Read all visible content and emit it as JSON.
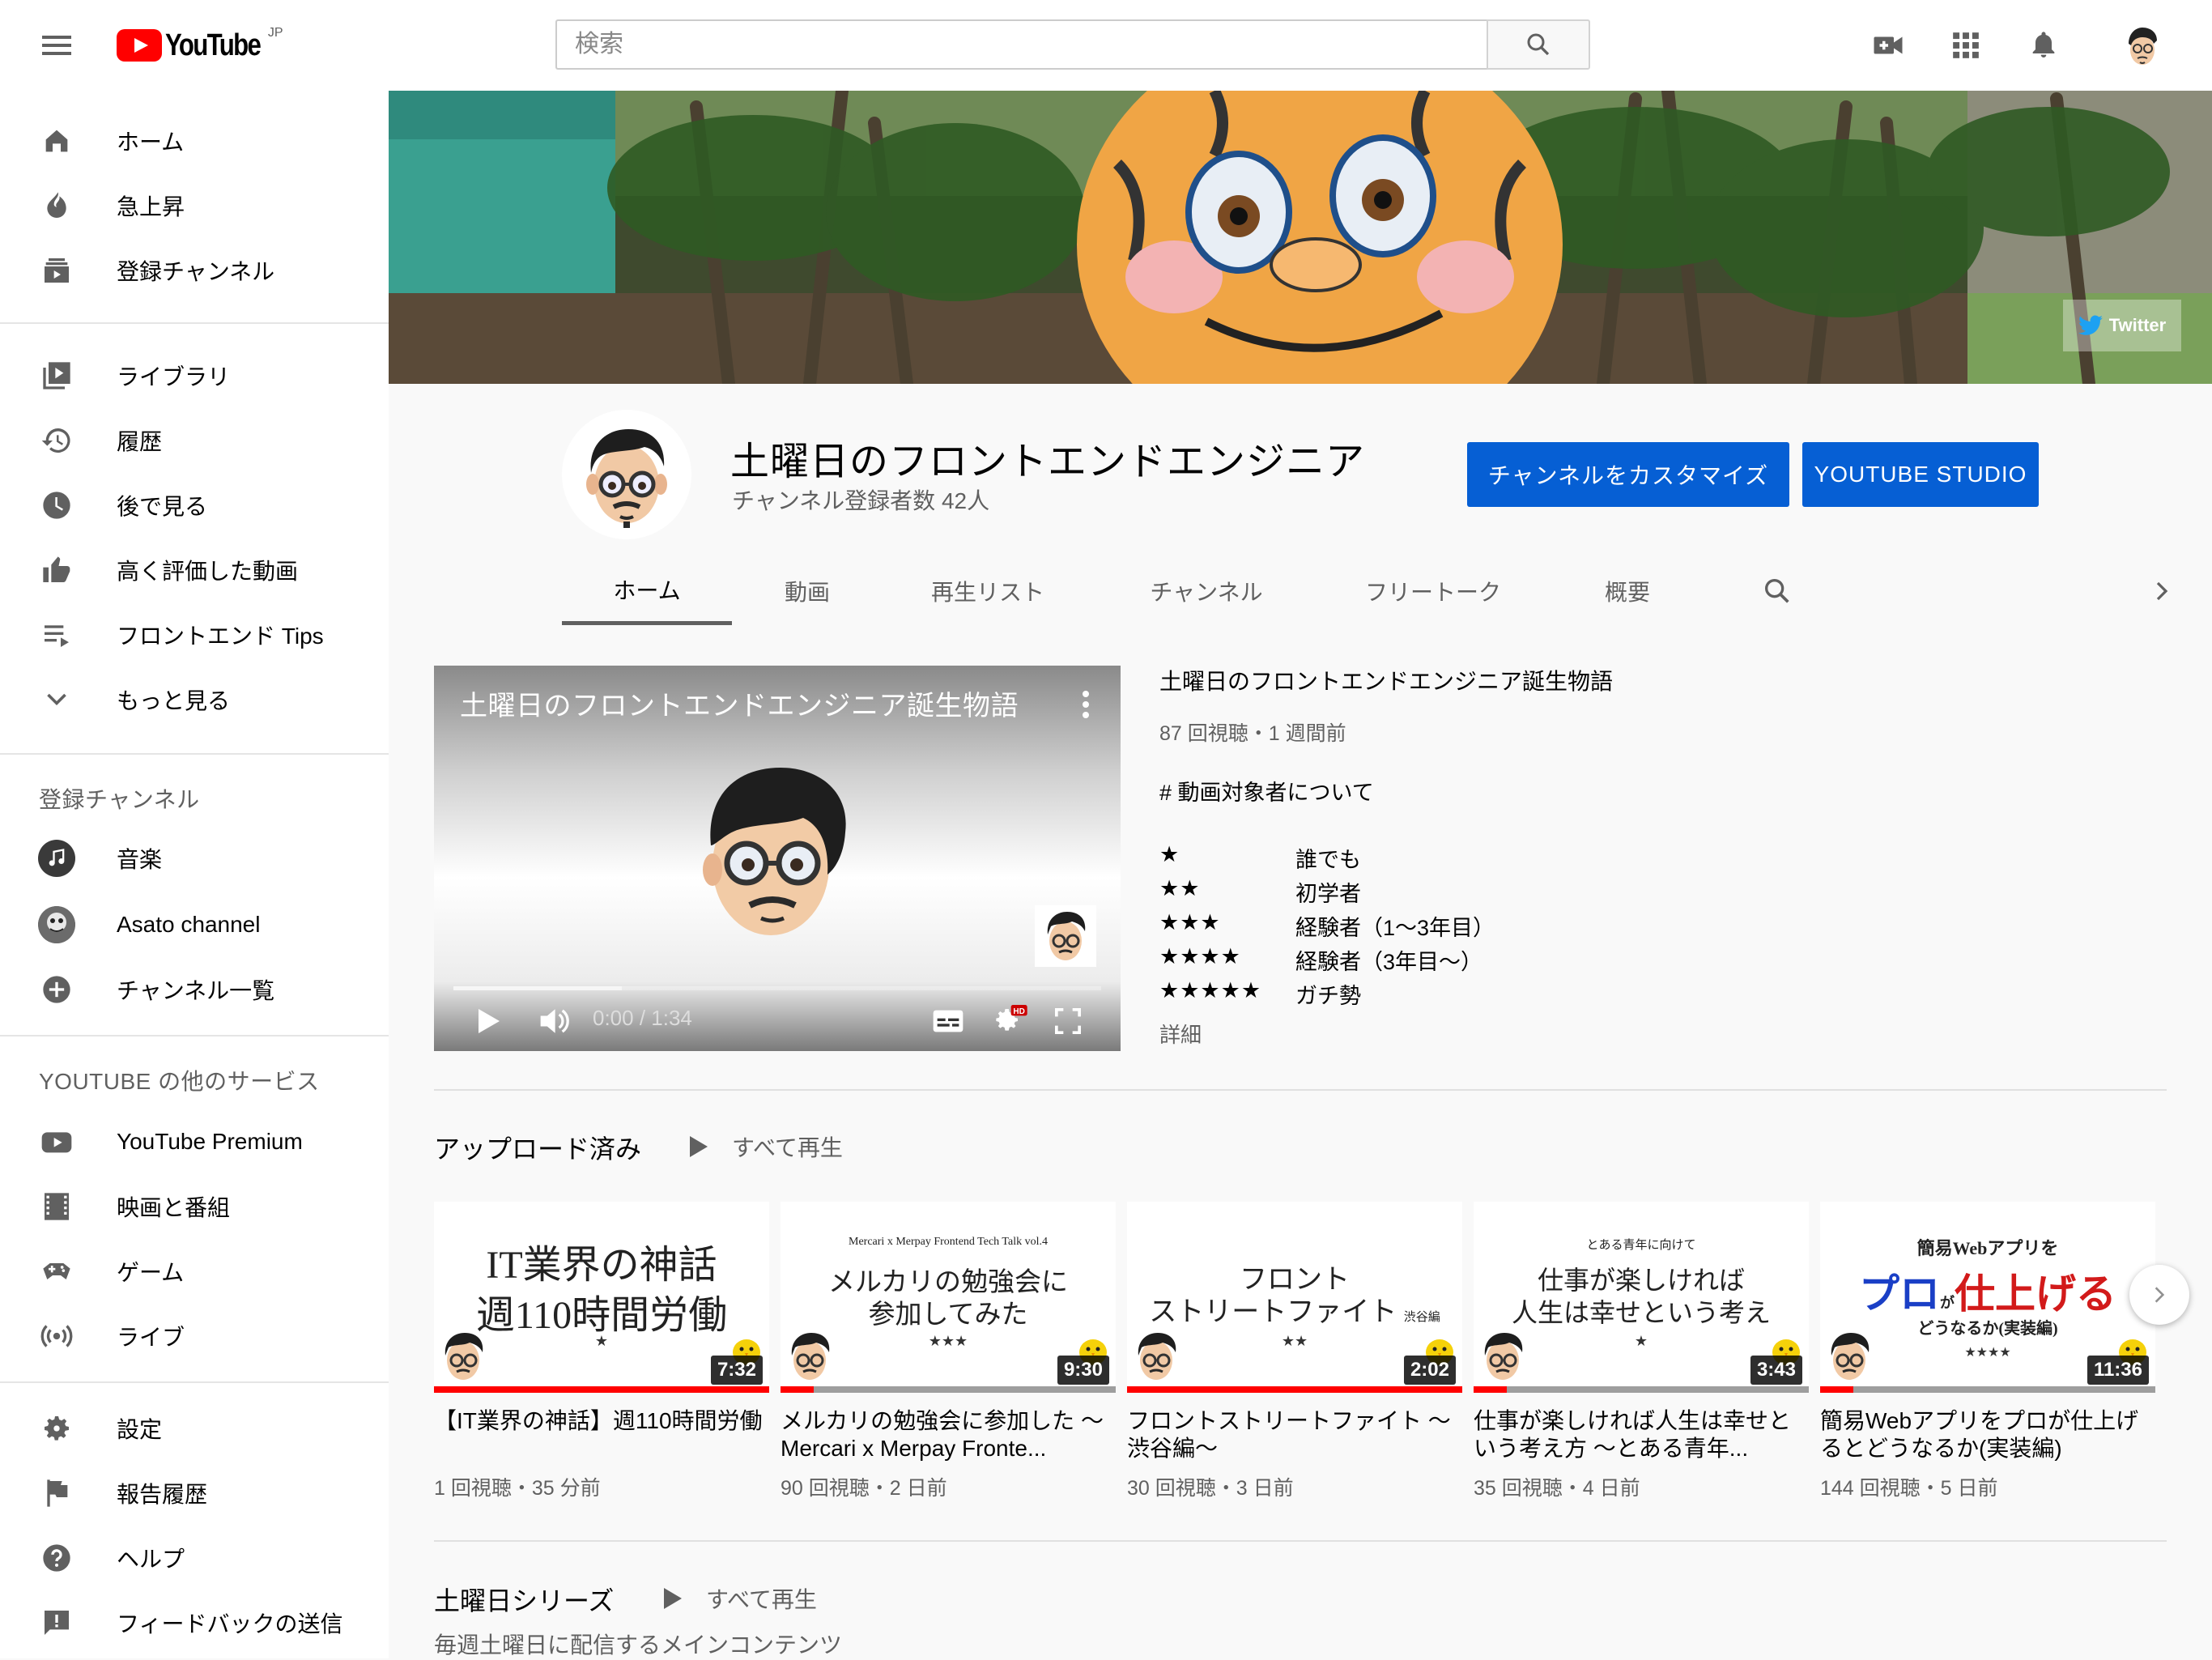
{
  "masthead": {
    "logo_text": "YouTube",
    "region": "JP",
    "search_placeholder": "検索"
  },
  "sidebar": {
    "main": [
      {
        "label": "ホーム",
        "icon": "home-icon"
      },
      {
        "label": "急上昇",
        "icon": "trending-icon"
      },
      {
        "label": "登録チャンネル",
        "icon": "subscriptions-icon"
      }
    ],
    "library": [
      {
        "label": "ライブラリ",
        "icon": "library-icon"
      },
      {
        "label": "履歴",
        "icon": "history-icon"
      },
      {
        "label": "後で見る",
        "icon": "watch-later-icon"
      },
      {
        "label": "高く評価した動画",
        "icon": "thumbs-up-icon"
      },
      {
        "label": "フロントエンド Tips",
        "icon": "playlist-icon"
      },
      {
        "label": "もっと見る",
        "icon": "chevron-down-icon"
      }
    ],
    "subscriptions_heading": "登録チャンネル",
    "subscriptions": [
      {
        "label": "音楽",
        "icon": "music-icon"
      },
      {
        "label": "Asato channel",
        "icon": "channel-avatar"
      },
      {
        "label": "チャンネル一覧",
        "icon": "add-circle-icon"
      }
    ],
    "more_heading": "YOUTUBE の他のサービス",
    "more": [
      {
        "label": "YouTube Premium",
        "icon": "youtube-premium-icon"
      },
      {
        "label": "映画と番組",
        "icon": "film-icon"
      },
      {
        "label": "ゲーム",
        "icon": "gaming-icon"
      },
      {
        "label": "ライブ",
        "icon": "live-icon"
      }
    ],
    "footer": [
      {
        "label": "設定",
        "icon": "settings-icon"
      },
      {
        "label": "報告履歴",
        "icon": "flag-icon"
      },
      {
        "label": "ヘルプ",
        "icon": "help-icon"
      },
      {
        "label": "フィードバックの送信",
        "icon": "feedback-icon"
      }
    ]
  },
  "banner": {
    "twitter_label": "Twitter"
  },
  "channel": {
    "title": "土曜日のフロントエンドエンジニア",
    "subscribers": "チャンネル登録者数 42人",
    "customize_label": "チャンネルをカスタマイズ",
    "studio_label": "YOUTUBE STUDIO",
    "tabs": [
      "ホーム",
      "動画",
      "再生リスト",
      "チャンネル",
      "フリートーク",
      "概要"
    ],
    "active_tab": "ホーム"
  },
  "featured": {
    "player_title": "土曜日のフロントエンドエンジニア誕生物語",
    "time": "0:00 / 1:34",
    "progress_buffered": 0.26,
    "title": "土曜日のフロントエンドエンジニア誕生物語",
    "meta": "87 回視聴・1 週間前",
    "desc_heading": "# 動画対象者について",
    "levels": [
      {
        "stars": "★",
        "label": "誰でも"
      },
      {
        "stars": "★★",
        "label": "初学者"
      },
      {
        "stars": "★★★",
        "label": "経験者（1〜3年目）"
      },
      {
        "stars": "★★★★",
        "label": "経験者（3年目〜）"
      },
      {
        "stars": "★★★★★",
        "label": "ガチ勢"
      }
    ],
    "more_label": "詳細"
  },
  "uploads": {
    "title": "アップロード済み",
    "play_all": "すべて再生",
    "videos": [
      {
        "thumb_lines": [
          "IT業界の神話",
          "週110時間労働",
          "★"
        ],
        "duration": "7:32",
        "watched": 1.0,
        "title": "【IT業界の神話】週110時間労働",
        "meta": "1 回視聴・35 分前"
      },
      {
        "thumb_lines": [
          "Mercari x Merpay Frontend Tech Talk vol.4",
          "メルカリの勉強会に",
          "参加してみた",
          "★★★"
        ],
        "duration": "9:30",
        "watched": 0.1,
        "title": "メルカリの勉強会に参加した 〜 Mercari x Merpay Fronte...",
        "meta": "90 回視聴・2 日前"
      },
      {
        "thumb_lines": [
          "フロント",
          "ストリートファイト",
          "渋谷編",
          "★★"
        ],
        "duration": "2:02",
        "watched": 1.0,
        "title": "フロントストリートファイト 〜渋谷編〜",
        "meta": "30 回視聴・3 日前"
      },
      {
        "thumb_lines": [
          "とある青年に向けて",
          "仕事が楽しければ",
          "人生は幸せという考え",
          "★"
        ],
        "duration": "3:43",
        "watched": 0.1,
        "title": "仕事が楽しければ人生は幸せという考え方 〜とある青年...",
        "meta": "35 回視聴・4 日前"
      },
      {
        "thumb_lines": [
          "簡易Webアプリを",
          "プロ",
          "が",
          "仕上げる",
          "どうなるか(実装編)",
          "★★★★"
        ],
        "duration": "11:36",
        "watched": 0.1,
        "title": "簡易Webアプリをプロが仕上げるとどうなるか(実装編)",
        "meta": "144 回視聴・5 日前"
      }
    ]
  },
  "series": {
    "title": "土曜日シリーズ",
    "play_all": "すべて再生",
    "description": "毎週土曜日に配信するメインコンテンツ"
  },
  "colors": {
    "brand_red": "#ff0000",
    "button_blue": "#065fd4",
    "secondary_text": "#606060"
  }
}
